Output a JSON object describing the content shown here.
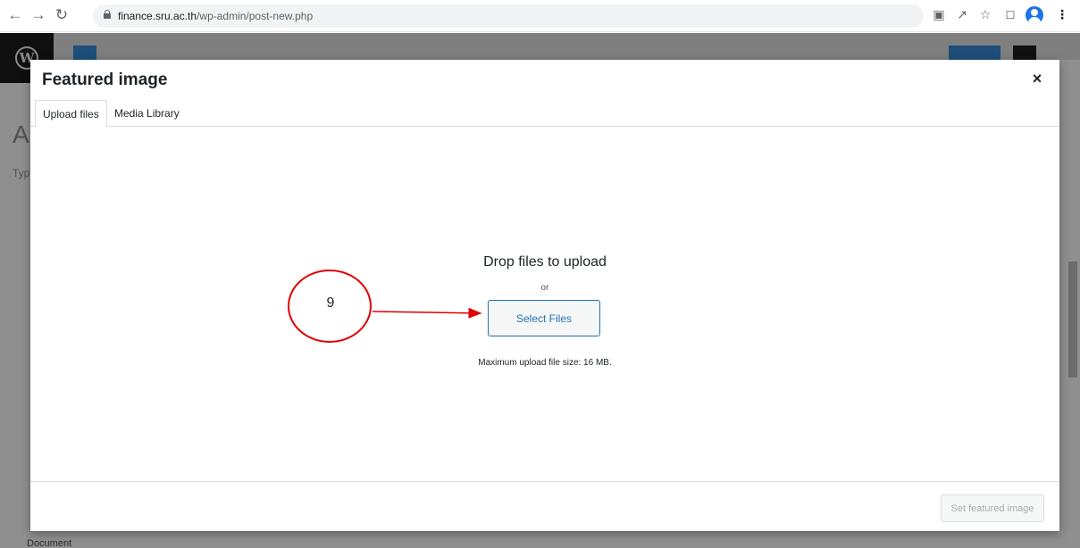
{
  "browser": {
    "url_host": "finance.sru.ac.th",
    "url_path": "/wp-admin/post-new.php",
    "icons": [
      "back-arrow-icon",
      "forward-arrow-icon",
      "reload-icon",
      "lock-icon",
      "translate-icon",
      "share-icon",
      "star-icon",
      "side-panel-icon",
      "profile-icon",
      "kebab-menu-icon"
    ]
  },
  "background": {
    "logo_letter": "W",
    "title_fragment": "A",
    "text_fragment": "Typ",
    "footer_label": "Document"
  },
  "modal": {
    "title": "Featured image",
    "close_label": "×",
    "tabs": [
      {
        "label": "Upload files",
        "active": true
      },
      {
        "label": "Media Library",
        "active": false
      }
    ],
    "drop_title": "Drop files to upload",
    "or_label": "or",
    "select_files_label": "Select Files",
    "max_size_text": "Maximum upload file size: 16 MB.",
    "set_featured_label": "Set featured image"
  },
  "annotation": {
    "step_number": "9",
    "color": "#e00000"
  },
  "colors": {
    "wp_blue": "#2271b1",
    "overlay_gray": "#8f8f8f"
  }
}
